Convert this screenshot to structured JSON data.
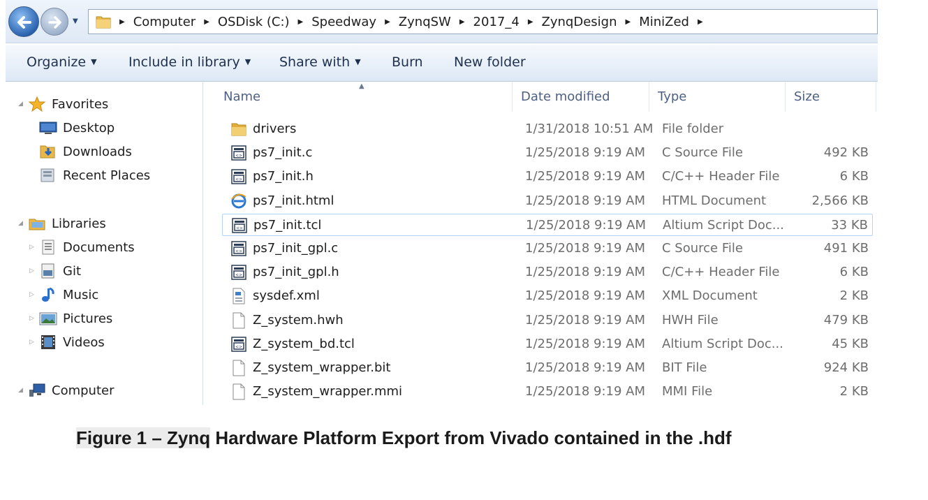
{
  "address": {
    "breadcrumbs": [
      "Computer",
      "OSDisk (C:)",
      "Speedway",
      "ZynqSW",
      "2017_4",
      "ZynqDesign",
      "MiniZed"
    ]
  },
  "toolbar": {
    "organize": "Organize",
    "include_in_library": "Include in library",
    "share_with": "Share with",
    "burn": "Burn",
    "new_folder": "New folder"
  },
  "nav": {
    "favorites": "Favorites",
    "desktop": "Desktop",
    "downloads": "Downloads",
    "recent_places": "Recent Places",
    "libraries": "Libraries",
    "documents": "Documents",
    "git": "Git",
    "music": "Music",
    "pictures": "Pictures",
    "videos": "Videos",
    "computer": "Computer"
  },
  "columns": {
    "name": "Name",
    "date_modified": "Date modified",
    "type": "Type",
    "size": "Size"
  },
  "files": [
    {
      "name": "drivers",
      "date": "1/31/2018 10:51 AM",
      "type": "File folder",
      "size": "",
      "icon": "folder-icon"
    },
    {
      "name": "ps7_init.c",
      "date": "1/25/2018 9:19 AM",
      "type": "C Source File",
      "size": "492 KB",
      "icon": "source-file-icon"
    },
    {
      "name": "ps7_init.h",
      "date": "1/25/2018 9:19 AM",
      "type": "C/C++ Header File",
      "size": "6 KB",
      "icon": "source-file-icon"
    },
    {
      "name": "ps7_init.html",
      "date": "1/25/2018 9:19 AM",
      "type": "HTML Document",
      "size": "2,566 KB",
      "icon": "ie-html-icon"
    },
    {
      "name": "ps7_init.tcl",
      "date": "1/25/2018 9:19 AM",
      "type": "Altium Script Doc...",
      "size": "33 KB",
      "icon": "source-file-icon"
    },
    {
      "name": "ps7_init_gpl.c",
      "date": "1/25/2018 9:19 AM",
      "type": "C Source File",
      "size": "491 KB",
      "icon": "source-file-icon"
    },
    {
      "name": "ps7_init_gpl.h",
      "date": "1/25/2018 9:19 AM",
      "type": "C/C++ Header File",
      "size": "6 KB",
      "icon": "source-file-icon"
    },
    {
      "name": "sysdef.xml",
      "date": "1/25/2018 9:19 AM",
      "type": "XML Document",
      "size": "2 KB",
      "icon": "xml-file-icon"
    },
    {
      "name": "Z_system.hwh",
      "date": "1/25/2018 9:19 AM",
      "type": "HWH File",
      "size": "479 KB",
      "icon": "blank-file-icon"
    },
    {
      "name": "Z_system_bd.tcl",
      "date": "1/25/2018 9:19 AM",
      "type": "Altium Script Doc...",
      "size": "45 KB",
      "icon": "source-file-icon"
    },
    {
      "name": "Z_system_wrapper.bit",
      "date": "1/25/2018 9:19 AM",
      "type": "BIT File",
      "size": "924 KB",
      "icon": "blank-file-icon"
    },
    {
      "name": "Z_system_wrapper.mmi",
      "date": "1/25/2018 9:19 AM",
      "type": "MMI File",
      "size": "2 KB",
      "icon": "blank-file-icon"
    }
  ],
  "caption": {
    "part1": "Figure 1 – Zynq",
    "part2": " Hardware Platform Export from Vivado contained in the .hdf"
  }
}
